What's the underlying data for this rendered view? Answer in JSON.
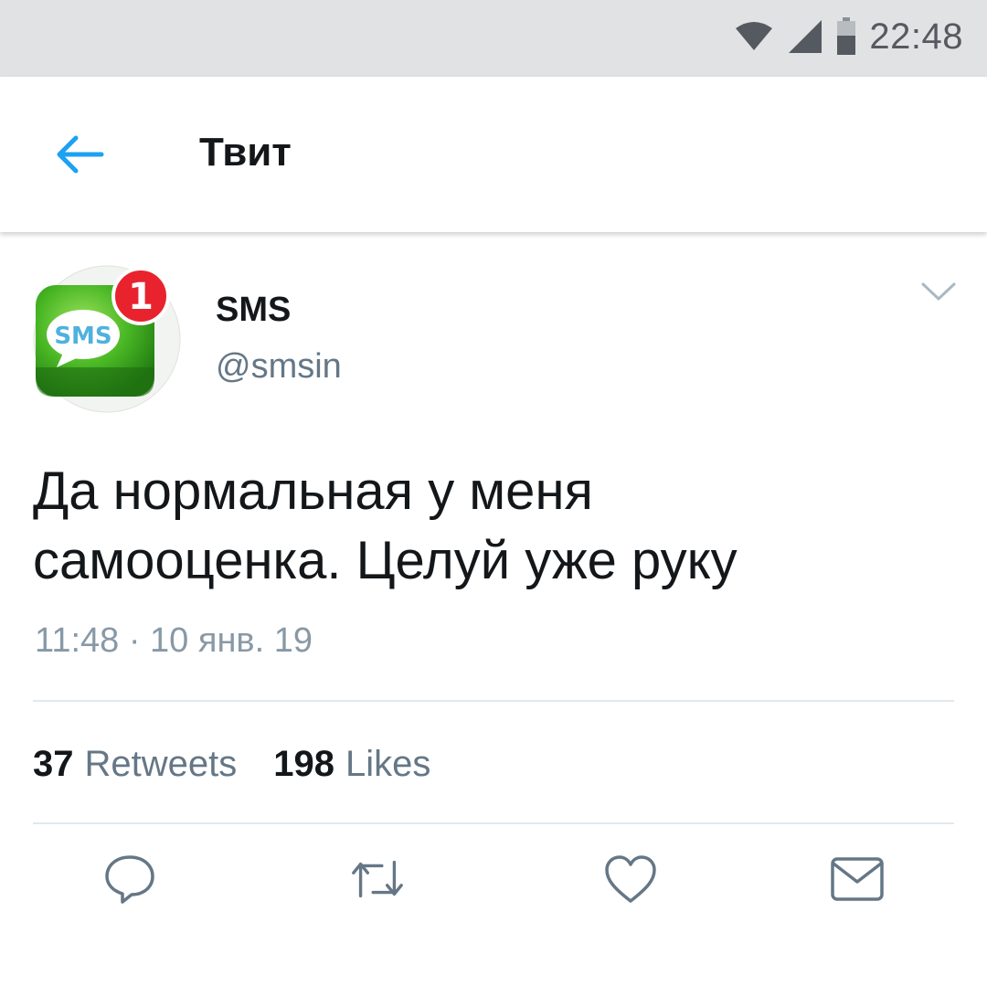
{
  "status_bar": {
    "time": "22:48",
    "icons": [
      "wifi-icon",
      "signal-icon",
      "battery-icon"
    ]
  },
  "header": {
    "back_icon": "arrow-left-icon",
    "title": "Твит"
  },
  "tweet": {
    "author": {
      "name": "SMS",
      "handle": "@smsin",
      "avatar": {
        "icon": "sms-app-icon",
        "badge_count": "1",
        "badge_text": "SMS"
      }
    },
    "menu_icon": "chevron-down-icon",
    "text_line1": "Да нормальная у меня",
    "text_line2": "самооценка. Целуй уже руку",
    "timestamp": "11:48 · 10 янв. 19",
    "stats": {
      "retweets_count": "37",
      "retweets_label": "Retweets",
      "likes_count": "198",
      "likes_label": "Likes"
    },
    "actions": [
      "reply-icon",
      "retweet-icon",
      "like-icon",
      "message-icon"
    ]
  },
  "colors": {
    "accent": "#1da1f2",
    "text_primary": "#14171a",
    "text_secondary": "#657786",
    "status_bar_bg": "#e1e2e4",
    "icon_gray": "#657786"
  }
}
